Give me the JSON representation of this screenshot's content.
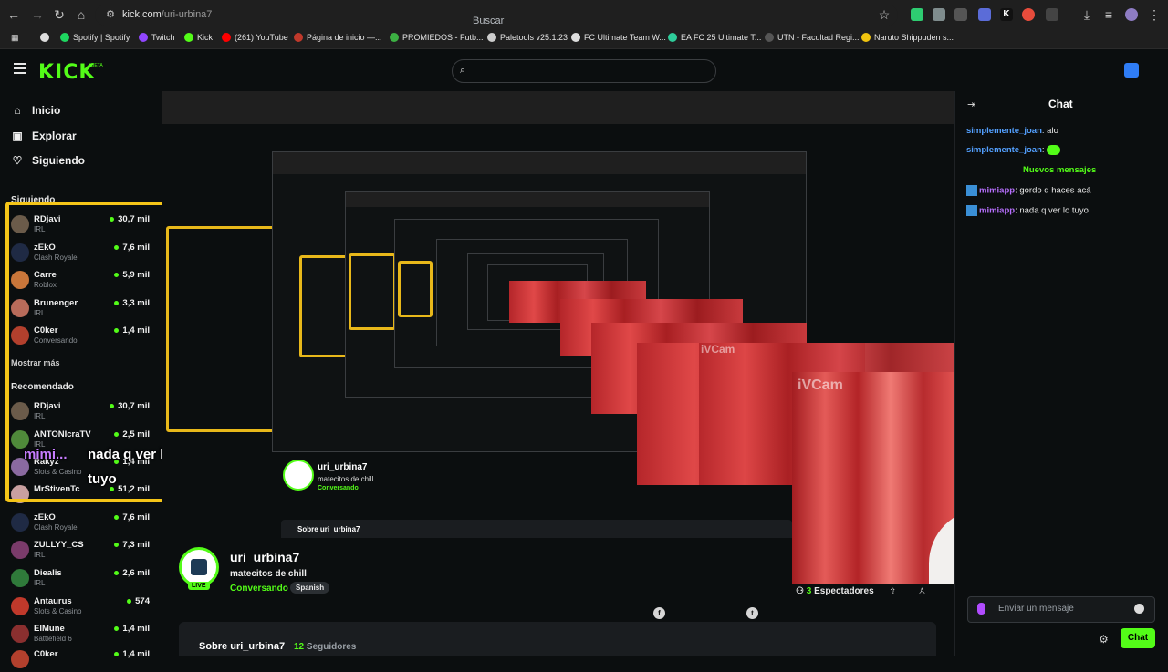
{
  "browser": {
    "url_host": "kick.com",
    "url_path": "/uri-urbina7",
    "bookmarks": [
      {
        "label": "Spotify | Spotify",
        "color": "#1ed760"
      },
      {
        "label": "Twitch",
        "color": "#9146ff"
      },
      {
        "label": "Kick",
        "color": "#53fc18"
      },
      {
        "label": "(261) YouTube",
        "color": "#ff0000"
      },
      {
        "label": "Página de inicio —...",
        "color": "#c0392b"
      },
      {
        "label": "PROMIEDOS - Futb...",
        "color": "#3cb043"
      },
      {
        "label": "Paletools v25.1.23",
        "color": "#cccccc"
      },
      {
        "label": "FC Ultimate Team W...",
        "color": "#dddddd"
      },
      {
        "label": "EA FC 25 Ultimate T...",
        "color": "#2ecc9a"
      },
      {
        "label": "UTN - Facultad Regi...",
        "color": "#555555"
      },
      {
        "label": "Naruto Shippuden s...",
        "color": "#f1c40f"
      }
    ]
  },
  "header": {
    "logo": "KICK",
    "logo_badge": "BETA",
    "search_placeholder": "Buscar"
  },
  "sidebar": {
    "nav": [
      {
        "label": "Inicio",
        "icon": "home-icon"
      },
      {
        "label": "Explorar",
        "icon": "compass-icon"
      },
      {
        "label": "Siguiendo",
        "icon": "heart-icon"
      }
    ],
    "following_title": "Siguiendo",
    "following": [
      {
        "name": "RDjavi",
        "category": "IRL",
        "viewers": "30,7 mil",
        "color": "#6b5b4a"
      },
      {
        "name": "zEkO",
        "category": "Clash Royale",
        "viewers": "7,6 mil",
        "color": "#1f2a44"
      },
      {
        "name": "Carre",
        "category": "Roblox",
        "viewers": "5,9 mil",
        "color": "#c9763a"
      },
      {
        "name": "Brunenger",
        "category": "IRL",
        "viewers": "3,3 mil",
        "color": "#b86b5a"
      },
      {
        "name": "C0ker",
        "category": "Conversando",
        "viewers": "1,4 mil",
        "color": "#b3402d"
      }
    ],
    "show_more": "Mostrar más",
    "recommended_title": "Recomendado",
    "recommended": [
      {
        "name": "RDjavi",
        "category": "IRL",
        "viewers": "30,7 mil",
        "color": "#6b5b4a"
      },
      {
        "name": "ANTONIcraTV",
        "category": "IRL",
        "viewers": "2,5 mil",
        "color": "#4f8a3a"
      },
      {
        "name": "Rakyz",
        "category": "Slots & Casino",
        "viewers": "1,4 mil",
        "color": "#8a6aa0"
      },
      {
        "name": "MrStivenTc",
        "category": "",
        "viewers": "51,2 mil",
        "color": "#c9a0a0"
      },
      {
        "name": "zEkO",
        "category": "Clash Royale",
        "viewers": "7,6 mil",
        "color": "#1f2a44"
      },
      {
        "name": "ZULLYY_CS",
        "category": "IRL",
        "viewers": "7,3 mil",
        "color": "#7a3b6a"
      },
      {
        "name": "Diealis",
        "category": "IRL",
        "viewers": "2,6 mil",
        "color": "#2f7a3a"
      },
      {
        "name": "Antaurus",
        "category": "Slots & Casino",
        "viewers": "574",
        "color": "#c0392b"
      },
      {
        "name": "ElMune",
        "category": "Battlefield 6",
        "viewers": "1,4 mil",
        "color": "#8a2f2f"
      },
      {
        "name": "C0ker",
        "category": "",
        "viewers": "1,4 mil",
        "color": "#b3402d"
      }
    ],
    "overlay_user": "mimi...",
    "overlay_text_1": "nada q ver lo",
    "overlay_text_2": "tuyo"
  },
  "player": {
    "cam_label": "iVCam"
  },
  "stream": {
    "streamer": "uri_urbina7",
    "title": "matecitos de chill",
    "category": "Conversando",
    "language": "Spanish",
    "live_badge": "LIVE",
    "viewers_count": "3",
    "viewers_label": "Espectadores",
    "about_title": "Sobre uri_urbina7",
    "followers_count": "12",
    "followers_label": "Seguidores"
  },
  "chat": {
    "title": "Chat",
    "messages": [
      {
        "user": "simplemente_joan",
        "text": ": alo"
      },
      {
        "user": "simplemente_joan",
        "text": ": "
      }
    ],
    "new_messages_label": "Nuevos mensajes",
    "new_messages": [
      {
        "user": "mimiapp",
        "text": ": gordo q haces acá"
      },
      {
        "user": "mimiapp",
        "text": ": nada q ver lo tuyo"
      }
    ],
    "input_placeholder": "Enviar un mensaje",
    "send_button": "Chat"
  },
  "colors": {
    "accent": "#53fc18",
    "highlight_border": "#f5c518"
  }
}
